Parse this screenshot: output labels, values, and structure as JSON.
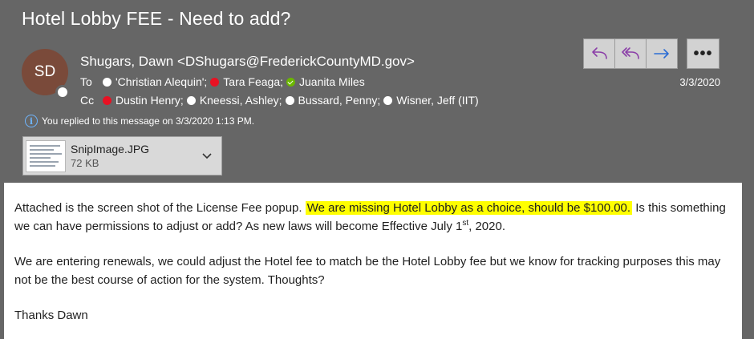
{
  "subject": "Hotel Lobby FEE - Need to add?",
  "avatar_initials": "SD",
  "sender": "Shugars, Dawn <DShugars@FrederickCountyMD.gov>",
  "to_label": "To",
  "to": [
    {
      "name": "'Christian Alequin';",
      "presence": "white"
    },
    {
      "name": "Tara Feaga;",
      "presence": "red"
    },
    {
      "name": "Juanita Miles",
      "presence": "green"
    }
  ],
  "cc_label": "Cc",
  "cc": [
    {
      "name": "Dustin Henry;",
      "presence": "red"
    },
    {
      "name": "Kneessi, Ashley;",
      "presence": "white"
    },
    {
      "name": "Bussard, Penny;",
      "presence": "white"
    },
    {
      "name": "Wisner, Jeff (IIT)",
      "presence": "white"
    }
  ],
  "info_text": "You replied to this message on 3/3/2020 1:13 PM.",
  "attachment": {
    "name": "SnipImage.JPG",
    "size": "72 KB"
  },
  "date": "3/3/2020",
  "more_label": "•••",
  "colors": {
    "reply": "#8b3fa8",
    "reply_all": "#8b3fa8",
    "forward": "#2b6cd4",
    "highlight": "#ffff00",
    "info": "#6fb6ff"
  },
  "body": {
    "p1_a": "Attached is the screen shot of the License Fee popup.",
    "p1_highlight": "We are missing Hotel Lobby as a choice, should be $100.00.",
    "p1_b": "Is this something we can have permissions to adjust or add? As new laws will become Effective July 1",
    "p1_sup": "st",
    "p1_c": ", 2020.",
    "p2": "We are entering renewals, we could adjust the Hotel fee to match be the Hotel Lobby fee but we know for tracking purposes this may not be the best course of action for the system.  Thoughts?",
    "p3": "Thanks Dawn"
  }
}
